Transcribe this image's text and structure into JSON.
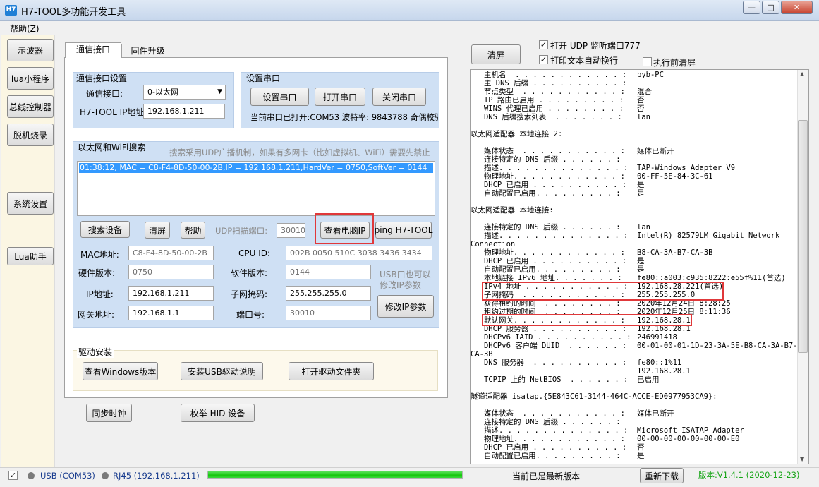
{
  "window": {
    "icon_text": "H7",
    "title": "H7-TOOL多功能开发工具",
    "min": "—",
    "max": "□",
    "close": "✕"
  },
  "menu": {
    "help": "帮助(Z)"
  },
  "sidebar": {
    "oscilloscope": "示波器",
    "lua_program": "lua小程序",
    "bus_controller": "总线控制器",
    "offline_burn": "脱机烧录",
    "system_settings": "系统设置",
    "lua_assistant": "Lua助手"
  },
  "tabs": {
    "comm": "通信接口",
    "firmware": "固件升级"
  },
  "comm_group": {
    "title": "通信接口设置",
    "iface_label": "通信接口:",
    "iface_value": "0-以太网",
    "ip_label": "H7-TOOL IP地址:",
    "ip_value": "192.168.1.211"
  },
  "serial_group": {
    "title": "设置串口",
    "setup": "设置串口",
    "open": "打开串口",
    "close": "关闭串口",
    "status": "当前串口已打开:COM53 波特率: 9843788   奇偶校验:"
  },
  "search_group": {
    "title": "以太网和WiFi搜索",
    "hint": "搜索采用UDP广播机制，如果有多网卡（比如虚拟机、WiFi）需要先禁止",
    "list_item": "01:38:12, MAC = C8-F4-8D-50-00-2B,IP = 192.168.1.211,HardVer = 0750,SoftVer = 0144",
    "search_btn": "搜索设备",
    "clear_btn": "清屏",
    "help_btn": "帮助",
    "udp_port_label": "UDP扫描端口:",
    "udp_port_value": "30010",
    "view_pc_ip": "查看电脑IP",
    "ping": "ping H7-TOOL",
    "mac_label": "MAC地址:",
    "mac_value": "C8-F4-8D-50-00-2B",
    "cpu_label": "CPU ID:",
    "cpu_value": "002B 0050 510C 3038 3436 3434",
    "hw_label": "硬件版本:",
    "hw_value": "0750",
    "sw_label": "软件版本:",
    "sw_value": "0144",
    "usb_note": "USB口也可以修改IP参数",
    "ip_label": "IP地址:",
    "ip_value": "192.168.1.211",
    "mask_label": "子网掩码:",
    "mask_value": "255.255.255.0",
    "modify_ip": "修改IP参数",
    "gw_label": "网关地址:",
    "gw_value": "192.168.1.1",
    "port_label": "端口号:",
    "port_value": "30010"
  },
  "driver_group": {
    "title": "驱动安装",
    "win_ver": "查看Windows版本",
    "usb_guide": "安装USB驱动说明",
    "open_folder": "打开驱动文件夹"
  },
  "bottom_buttons": {
    "sync_clock": "同步时钟",
    "enum_hid": "枚举 HID 设备"
  },
  "right": {
    "clear": "清屏",
    "udp_monitor": "打开 UDP 监听端口777",
    "auto_wrap": "打印文本自动换行",
    "clear_before": "执行前清屏",
    "checkmark": "✓"
  },
  "log_lines": [
    {
      "k": "   主机名  . . . . . . . . . . . . :",
      "v": "byb-PC"
    },
    {
      "k": "   主 DNS 后缀 . . . . . . . . . . :",
      "v": ""
    },
    {
      "k": "   节点类型  . . . . . . . . . . . :",
      "v": "混合"
    },
    {
      "k": "   IP 路由已启用 . . . . . . . . . :",
      "v": "否"
    },
    {
      "k": "   WINS 代理已启用 . . . . . . . . :",
      "v": "否"
    },
    {
      "k": "   DNS 后缀搜索列表  . . . . . . . :",
      "v": "lan"
    },
    {
      "k": "",
      "v": ""
    },
    {
      "k": "以太网适配器 本地连接 2:",
      "v": ""
    },
    {
      "k": "",
      "v": ""
    },
    {
      "k": "   媒体状态  . . . . . . . . . . . :",
      "v": "媒体已断开"
    },
    {
      "k": "   连接特定的 DNS 后缀 . . . . . . :",
      "v": ""
    },
    {
      "k": "   描述. . . . . . . . . . . . . . :",
      "v": "TAP-Windows Adapter V9"
    },
    {
      "k": "   物理地址. . . . . . . . . . . . :",
      "v": "00-FF-5E-84-3C-61"
    },
    {
      "k": "   DHCP 已启用 . . . . . . . . . . :",
      "v": "是"
    },
    {
      "k": "   自动配置已启用. . . . . . . . . :",
      "v": "是"
    },
    {
      "k": "",
      "v": ""
    },
    {
      "k": "以太网适配器 本地连接:",
      "v": ""
    },
    {
      "k": "",
      "v": ""
    },
    {
      "k": "   连接特定的 DNS 后缀 . . . . . . :",
      "v": "lan"
    },
    {
      "k": "   描述. . . . . . . . . . . . . . :",
      "v": "Intel(R) 82579LM Gigabit Network"
    },
    {
      "k": "Connection",
      "v": ""
    },
    {
      "k": "   物理地址. . . . . . . . . . . . :",
      "v": "B8-CA-3A-B7-CA-3B"
    },
    {
      "k": "   DHCP 已启用 . . . . . . . . . . :",
      "v": "是"
    },
    {
      "k": "   自动配置已启用. . . . . . . . . :",
      "v": "是"
    },
    {
      "k": "   本地链接 IPv6 地址. . . . . . . :",
      "v": "fe80::a003:c935:8222:e55f%11(首选)"
    },
    {
      "k": "   IPv4 地址 . . . . . . . . . . . :",
      "v": "192.168.28.221(首选)"
    },
    {
      "k": "   子网掩码  . . . . . . . . . . . :",
      "v": "255.255.255.0"
    },
    {
      "k": "   获得租约的时间  . . . . . . . . :",
      "v": "2020年12月24日 8:28:25"
    },
    {
      "k": "   租约过期的时间  . . . . . . . . :",
      "v": "2020年12月25日 8:11:36"
    },
    {
      "k": "   默认网关. . . . . . . . . . . . :",
      "v": "192.168.28.1"
    },
    {
      "k": "   DHCP 服务器 . . . . . . . . . . :",
      "v": "192.168.28.1"
    },
    {
      "k": "   DHCPv6 IAID . . . . . . . . . . :",
      "v": "246991418"
    },
    {
      "k": "   DHCPv6 客户端 DUID  . . . . . . :",
      "v": "00-01-00-01-1D-23-3A-5E-B8-CA-3A-B7-"
    },
    {
      "k": "CA-3B",
      "v": ""
    },
    {
      "k": "   DNS 服务器  . . . . . . . . . . :",
      "v": "fe80::1%11"
    },
    {
      "k": "",
      "v": "192.168.28.1"
    },
    {
      "k": "   TCPIP 上的 NetBIOS  . . . . . . :",
      "v": "已启用"
    },
    {
      "k": "",
      "v": ""
    },
    {
      "k": "隧道适配器 isatap.{5E843C61-3144-464C-ACCE-ED0977953CA9}:",
      "v": ""
    },
    {
      "k": "",
      "v": ""
    },
    {
      "k": "   媒体状态  . . . . . . . . . . . :",
      "v": "媒体已断开"
    },
    {
      "k": "   连接特定的 DNS 后缀 . . . . . . :",
      "v": ""
    },
    {
      "k": "   描述. . . . . . . . . . . . . . :",
      "v": "Microsoft ISATAP Adapter"
    },
    {
      "k": "   物理地址. . . . . . . . . . . . :",
      "v": "00-00-00-00-00-00-00-E0"
    },
    {
      "k": "   DHCP 已启用 . . . . . . . . . . :",
      "v": "否"
    },
    {
      "k": "   自动配置已启用. . . . . . . . . :",
      "v": "是"
    }
  ],
  "status": {
    "usb": "USB (COM53)",
    "rj45": "RJ45 (192.168.1.211)",
    "progress": 1.0,
    "latest": "当前已是最新版本",
    "redownload": "重新下载",
    "version": "版本:V1.4.1 (2020-12-23)"
  },
  "colors": {
    "highlight_box": "#e0383a",
    "progress": "#16c60c",
    "version_text": "#17a517",
    "selection": "#3399ff"
  }
}
